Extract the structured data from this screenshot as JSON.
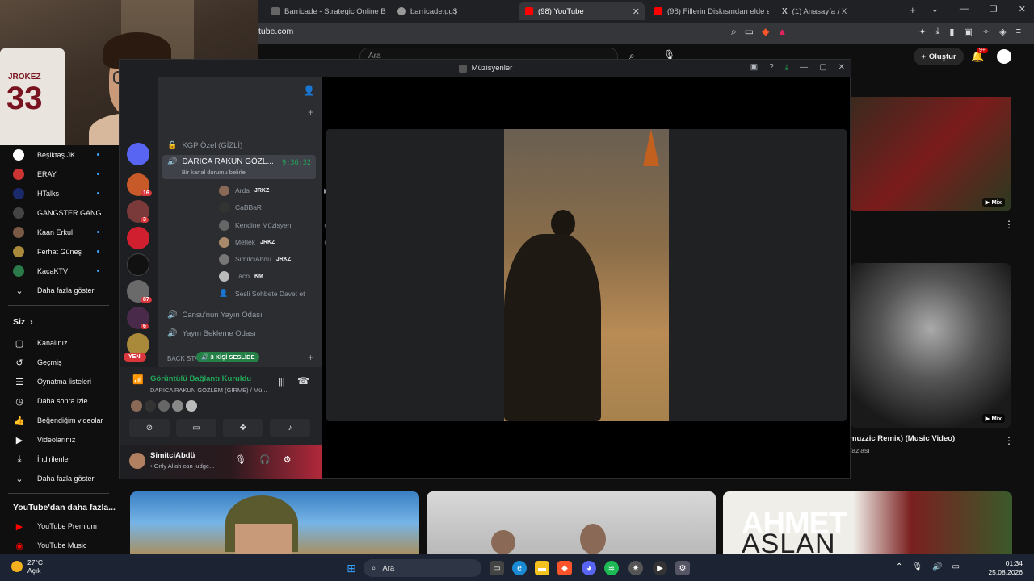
{
  "browser": {
    "tabs": [
      {
        "label": "Barricade - Strategic Online Board G",
        "active": false
      },
      {
        "label": "barricade.gg$",
        "active": false
      },
      {
        "label": "(98) YouTube",
        "active": true
      },
      {
        "label": "(98) Fillerin Dişkısından elde edilen",
        "active": false
      },
      {
        "label": "(1) Anasayfa / X",
        "active": false
      }
    ],
    "url": "tube.com"
  },
  "youtube": {
    "search_placeholder": "Ara",
    "create_label": "Oluştur",
    "notif_badge": "9+",
    "subscriptions": [
      "Beşiktaş JK",
      "ERAY",
      "HTalks",
      "GANGSTER GANG",
      "Kaan Erkul",
      "Ferhat Güneş",
      "KacaKTV"
    ],
    "show_more": "Daha fazla göster",
    "you_section": "Siz",
    "you_items": [
      "Kanalınız",
      "Geçmiş",
      "Oynatma listeleri",
      "Daha sonra izle",
      "Beğendiğim videolar",
      "Videolarınız",
      "İndirilenler",
      "Daha fazla göster"
    ],
    "more_from_yt": "YouTube'dan daha fazla...",
    "yt_items": [
      "YouTube Premium",
      "YouTube Music"
    ],
    "mix_label": "Mix",
    "video_title": "muzzic Remix) (Music Video)",
    "video_more": "fazlası",
    "ahmet_text": "AHMET",
    "aslan_text": "ASLAN"
  },
  "webcam": {
    "jersey_name": "JROKEZ",
    "jersey_number": "33"
  },
  "discord": {
    "window_title": "Müzisyenler",
    "server_badges": [
      "16",
      "3",
      "87",
      "6"
    ],
    "new_label": "YENİ",
    "channel_top": "KGP Özel (GİZLİ)",
    "active_channel": "DARICA RAKUN GÖZL...",
    "active_channel_sub": "Bir kanal durumu belirle",
    "active_channel_timer": "9:36:32",
    "voice_users": [
      {
        "name": "Arda",
        "tag": "JRKZ"
      },
      {
        "name": "CaBBaR",
        "tag": ""
      },
      {
        "name": "Kendine Müzisyen",
        "tag": ""
      },
      {
        "name": "Metlek",
        "tag": "JRKZ"
      },
      {
        "name": "SimitciAbdü",
        "tag": "JRKZ"
      },
      {
        "name": "Taco",
        "tag": "KM"
      }
    ],
    "invite_label": "Sesli Sohbete Davet et",
    "other_channels": [
      "Cansu'nun Yayın Odası",
      "Yayın Bekleme Odası"
    ],
    "category": "BACK STA",
    "live_pill": "3 KİŞİ SESLİDE",
    "voice_status": "Görüntülü Bağlantı Kuruldu",
    "voice_sub": "DARICA RAKUN GÖZLEM (GİRME) / Mü...",
    "user_name": "SimitciAbdü",
    "user_status": "• Only Allah can judge..."
  },
  "taskbar": {
    "weather_temp": "27°C",
    "weather_cond": "Açık",
    "search_label": "Ara",
    "time": "01:34",
    "date": "25.08.2026"
  }
}
